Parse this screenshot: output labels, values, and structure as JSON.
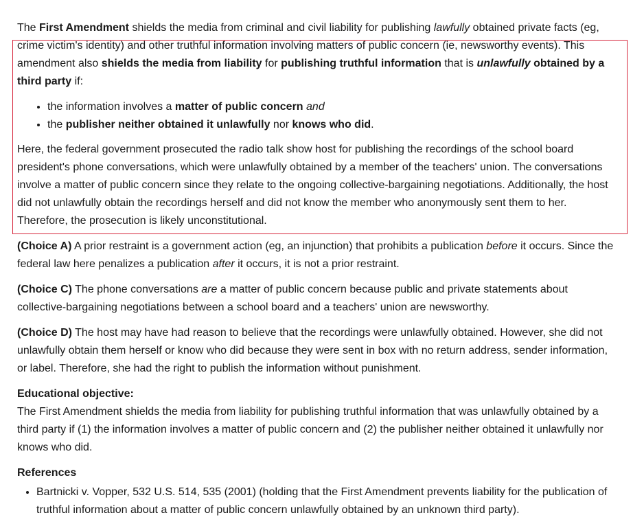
{
  "intro": {
    "s1": "The ",
    "s2": "First Amendment",
    "s3": " shields the media from criminal and civil liability for publishing ",
    "s4": "lawfully",
    "s5": " obtained private facts (eg, crime victim's identity) and other truthful information involving matters of public concern (ie, newsworthy events).  This amendment also ",
    "s6": "shields the media from liability",
    "s7": " for ",
    "s8": "publishing truthful information",
    "s9": " that is ",
    "s10": "unlawfully",
    "s11": " obtained by a third party",
    "s12": " if:"
  },
  "bullets": {
    "b1": {
      "s1": "the information involves a ",
      "s2": "matter of public concern",
      "s3": " ",
      "s4": "and"
    },
    "b2": {
      "s1": "the ",
      "s2": "publisher neither obtained it unlawfully",
      "s3": " nor ",
      "s4": "knows who did",
      "s5": "."
    }
  },
  "analysis": "Here, the federal government prosecuted the radio talk show host for publishing the recordings of the school board president's phone conversations, which were unlawfully obtained by a member of the teachers' union.  The conversations involve a matter of public concern since they relate to the ongoing collective-bargaining negotiations.  Additionally, the host did not unlawfully obtain the recordings herself and did not know the member who anonymously sent them to her.  Therefore, the prosecution is likely unconstitutional.",
  "choice_a": {
    "label": "(Choice A)",
    "s1": "  A prior restraint is a government action (eg, an injunction) that prohibits a publication ",
    "s2": "before",
    "s3": " it occurs.  Since the federal law here penalizes a publication ",
    "s4": "after",
    "s5": " it occurs, it is not a prior restraint."
  },
  "choice_c": {
    "label": "(Choice C)",
    "s1": "  The phone conversations ",
    "s2": "are",
    "s3": " a matter of public concern because public and private statements about collective-bargaining negotiations between a school board and a teachers' union are newsworthy."
  },
  "choice_d": {
    "label": "(Choice D)",
    "s1": "  The host may have had reason to believe that the recordings were unlawfully obtained.  However, she did not unlawfully obtain them herself or know who did because they were sent in box with no return address, sender information, or label.  Therefore, she had the right to publish the information without punishment."
  },
  "objective": {
    "heading": "Educational objective:",
    "text": "The First Amendment shields the media from liability for publishing truthful information that was unlawfully obtained by a third party if (1) the information involves a matter of public concern and (2) the publisher neither obtained it unlawfully nor knows who did."
  },
  "references": {
    "heading": "References",
    "items": [
      "Bartnicki v. Vopper, 532 U.S. 514, 535 (2001) (holding that the First Amendment prevents liability for the publication of truthful information about a matter of public concern unlawfully obtained by an unknown third party)."
    ]
  },
  "colors": {
    "highlight_border": "#d6243a",
    "text": "#1a1a1a"
  }
}
